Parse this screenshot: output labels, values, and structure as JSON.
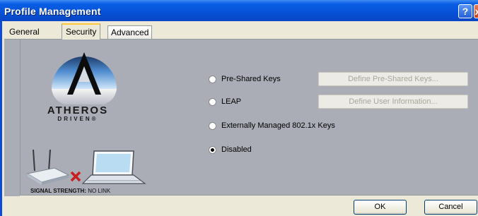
{
  "window": {
    "title": "Profile Management",
    "help_glyph": "?",
    "close_glyph": "x"
  },
  "tabs": [
    {
      "label": "General",
      "selected": false
    },
    {
      "label": "Security",
      "selected": true
    },
    {
      "label": "Advanced",
      "selected": false
    }
  ],
  "branding": {
    "name": "ATHEROS",
    "tagline": "DRIVEN",
    "trademark": "®",
    "logo_icon": "atheros-logo-icon"
  },
  "signal": {
    "label_key": "SIGNAL STRENGTH:",
    "label_value": "NO LINK",
    "graphic_icons": [
      "wireless-router-icon",
      "no-link-x-icon",
      "laptop-icon"
    ]
  },
  "security_options": [
    {
      "label": "Pre-Shared Keys",
      "checked": false,
      "button": "Define Pre-Shared Keys...",
      "button_enabled": false
    },
    {
      "label": "LEAP",
      "checked": false,
      "button": "Define User Information...",
      "button_enabled": false
    },
    {
      "label": "Externally Managed 802.1x Keys",
      "checked": false
    },
    {
      "label": "Disabled",
      "checked": true
    }
  ],
  "footer": {
    "ok_label": "OK",
    "cancel_label": "Cancel"
  },
  "colors": {
    "titlebar": "#0651d6",
    "dialog_face": "#ece9d8",
    "panel": "#aaadb5",
    "disabled_text": "#a8a799",
    "no_link_x": "#c81e1e"
  }
}
